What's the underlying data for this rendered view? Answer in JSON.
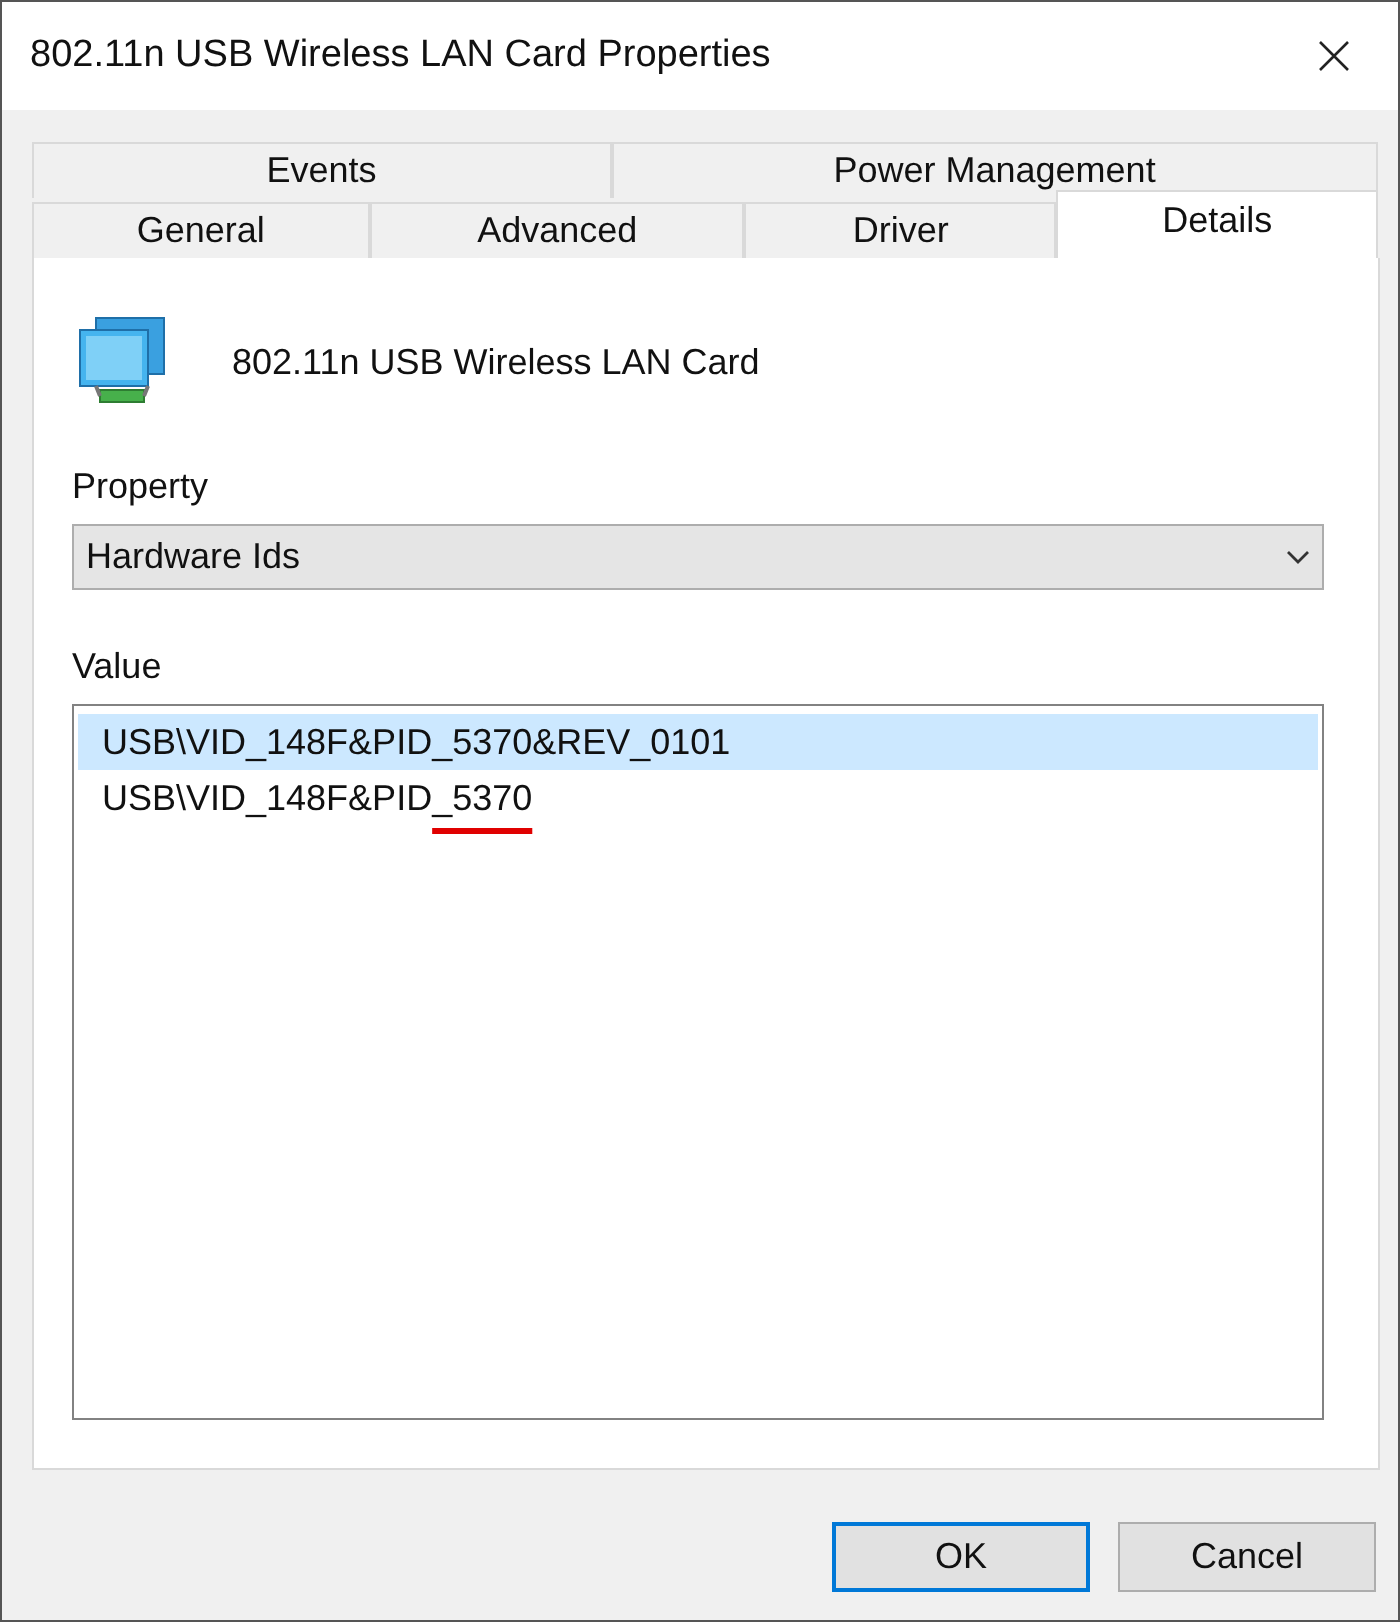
{
  "window": {
    "title": "802.11n USB Wireless LAN Card Properties"
  },
  "tab_rows": [
    [
      {
        "label": "Events",
        "selected": false
      },
      {
        "label": "Power Management",
        "selected": false
      }
    ],
    [
      {
        "label": "General",
        "selected": false
      },
      {
        "label": "Advanced",
        "selected": false
      },
      {
        "label": "Driver",
        "selected": false
      },
      {
        "label": "Details",
        "selected": true
      }
    ]
  ],
  "device": {
    "name": "802.11n USB Wireless LAN Card"
  },
  "property": {
    "label": "Property",
    "value": "Hardware Ids"
  },
  "value": {
    "label": "Value",
    "rows": [
      {
        "text": "USB\\VID_148F&PID_5370&REV_0101",
        "selected": true
      },
      {
        "text": "USB\\VID_148F&PID",
        "marked_text": "_5370",
        "selected": false
      }
    ]
  },
  "buttons": [
    {
      "label": "OK",
      "default": true
    },
    {
      "label": "Cancel",
      "default": false
    }
  ]
}
